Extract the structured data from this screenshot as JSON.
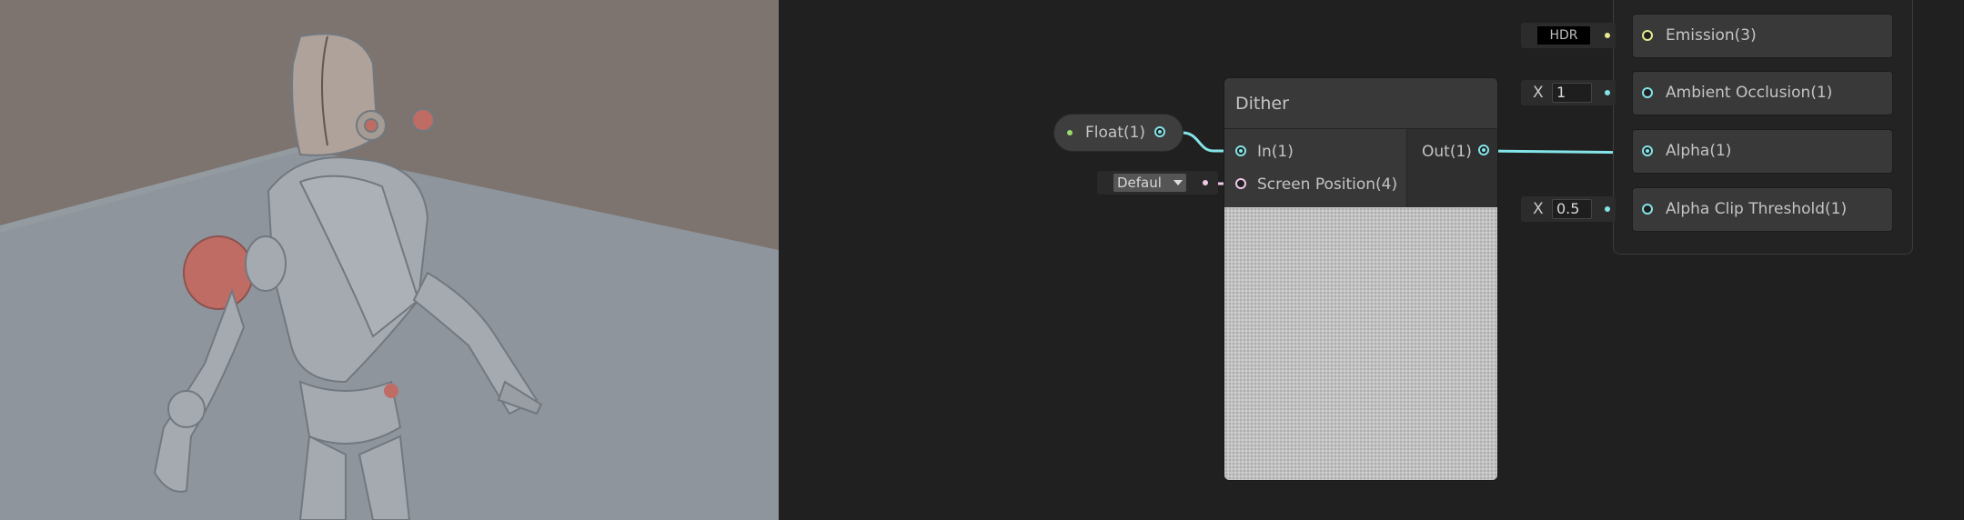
{
  "viewport": {
    "background": "#7c716a",
    "floor": "#8f979e",
    "robot": "#a8aeb4",
    "accent": "#c7675e"
  },
  "float_node": {
    "label": "Float(1)",
    "dot_color": "#9ad96a"
  },
  "dither_node": {
    "title": "Dither",
    "inputs": [
      "In(1)",
      "Screen Position(4)"
    ],
    "output": "Out(1)",
    "screen_position_default": "Defaul"
  },
  "master_stack": {
    "blocks": [
      {
        "label": "Emission(3)",
        "field_type": "HDR",
        "field_value": ""
      },
      {
        "label": "Ambient Occlusion(1)",
        "field_type": "X",
        "field_value": "1"
      },
      {
        "label": "Alpha(1)",
        "field_type": "",
        "field_value": ""
      },
      {
        "label": "Alpha Clip Threshold(1)",
        "field_type": "X",
        "field_value": "0.5"
      }
    ]
  },
  "colors": {
    "float_port": "#84e4e7",
    "vector_port": "#f0c8e8",
    "color_port": "#e8e890",
    "wire": "#84e4e7"
  }
}
